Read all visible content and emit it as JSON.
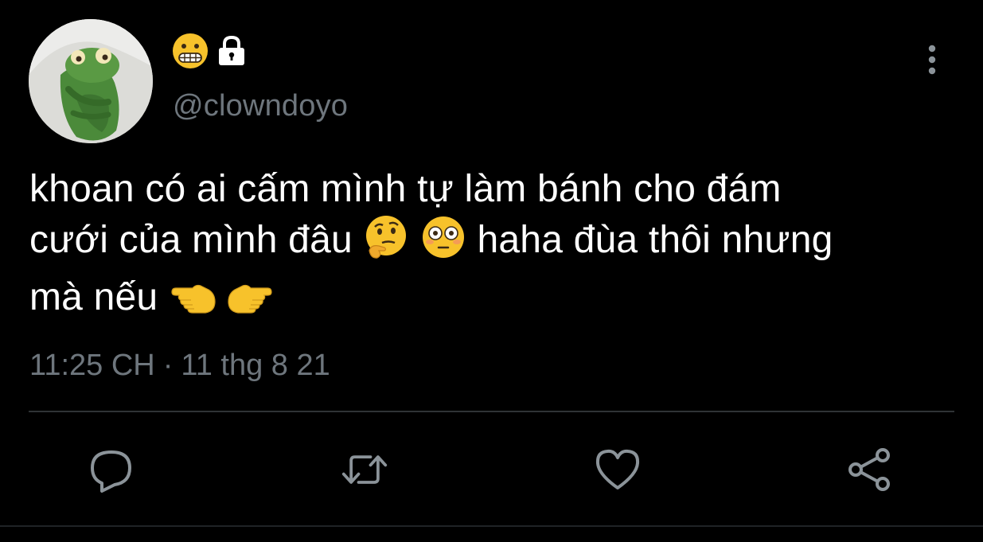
{
  "author": {
    "handle": "@clowndoyo",
    "name_emoji": "grimacing-face-emoji",
    "protected_icon": "lock-icon",
    "avatar": "green-plush-frog-avatar"
  },
  "tweet": {
    "text_line1": "khoan có ai cấm mình tự làm bánh cho đám",
    "text_line2_a": "cưới của mình đâu",
    "text_line2_b": "haha đùa thôi nhưng",
    "text_line3": "mà nếu",
    "emojis": [
      "thinking-face",
      "flushed-face",
      "pointing-left-hand",
      "pointing-right-hand"
    ]
  },
  "meta": {
    "time": "11:25 CH",
    "separator": "·",
    "date": "11 thg 8 21"
  },
  "actions": {
    "reply": "reply-icon",
    "retweet": "retweet-icon",
    "like": "heart-icon",
    "share": "share-icon"
  },
  "colors": {
    "background": "#000000",
    "text": "#ffffff",
    "secondary": "#6e767d",
    "divider": "#2f3336",
    "emoji_yellow": "#f7c22b"
  }
}
